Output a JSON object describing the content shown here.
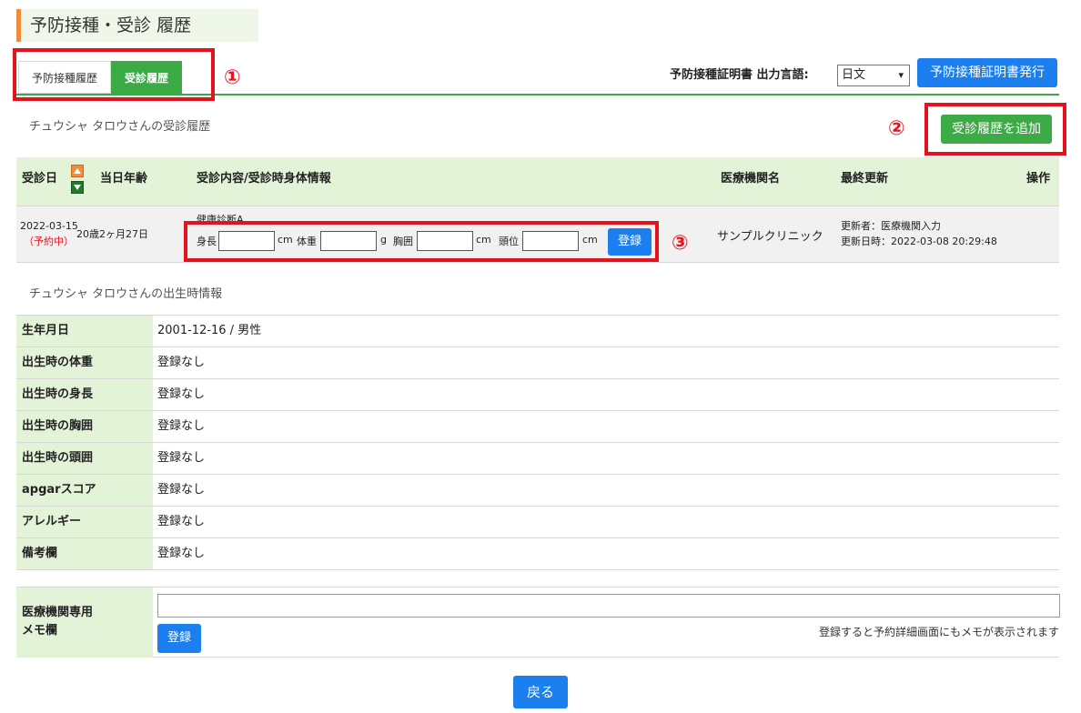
{
  "page": {
    "title": "予防接種・受診 履歴"
  },
  "tabs": [
    {
      "label": "予防接種履歴",
      "active": false
    },
    {
      "label": "受診履歴",
      "active": true
    }
  ],
  "annotations": {
    "one": "①",
    "two": "②",
    "three": "③",
    "color": "#e3121d"
  },
  "certificate": {
    "label": "予防接種証明書 出力言語:",
    "language_selected": "日文",
    "issue_button": "予防接種証明書発行"
  },
  "visits": {
    "subtitle": "チュウシャ タロウさんの受診履歴",
    "add_button": "受診履歴を追加",
    "headers": {
      "date": "受診日",
      "age": "当日年齢",
      "content": "受診内容/受診時身体情報",
      "clinic": "医療機関名",
      "updated": "最終更新",
      "action": "操作"
    },
    "rows": [
      {
        "date": "2022-03-15",
        "status": "（予約中）",
        "age": "20歳2ヶ月27日",
        "exam": "健康診断A",
        "height_label": "身長",
        "height_unit": "cm",
        "weight_label": "体重",
        "weight_unit": "g",
        "chest_label": "胸囲",
        "chest_unit": "cm",
        "head_label": "頭位",
        "head_unit": "cm",
        "register": "登録",
        "clinic": "サンプルクリニック",
        "updated_by": "更新者：医療機関入力",
        "updated_at": "更新日時：2022-03-08 20:29:48"
      }
    ]
  },
  "birth": {
    "subtitle": "チュウシャ タロウさんの出生時情報",
    "rows": [
      {
        "label": "生年月日",
        "value": "2001-12-16 / 男性"
      },
      {
        "label": "出生時の体重",
        "value": "登録なし"
      },
      {
        "label": "出生時の身長",
        "value": "登録なし"
      },
      {
        "label": "出生時の胸囲",
        "value": "登録なし"
      },
      {
        "label": "出生時の頭囲",
        "value": "登録なし"
      },
      {
        "label": "apgarスコア",
        "value": "登録なし"
      },
      {
        "label": "アレルギー",
        "value": "登録なし"
      },
      {
        "label": "備考欄",
        "value": "登録なし"
      }
    ]
  },
  "memo": {
    "label_line1": "医療機関専用",
    "label_line2": "メモ欄",
    "input_value": "",
    "register": "登録",
    "note": "登録すると予約詳細画面にもメモが表示されます"
  },
  "back_button": "戻る",
  "colors": {
    "accent_green": "#3dab45",
    "accent_blue": "#1b7ff0",
    "accent_orange": "#f08c3c",
    "header_bg": "#e2f3d8"
  }
}
